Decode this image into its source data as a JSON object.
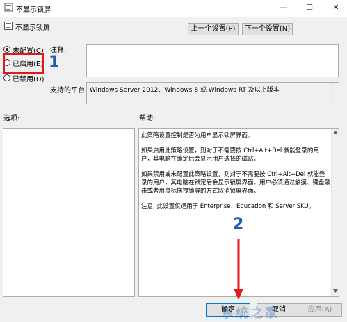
{
  "window": {
    "title": "不显示锁屏",
    "controls": {
      "minimize": "—",
      "maximize": "☐",
      "close": "✕"
    }
  },
  "header": {
    "title": "不显示锁屏"
  },
  "nav": {
    "prev_label": "上一个设置(P)",
    "next_label": "下一个设置(N)"
  },
  "radio": [
    {
      "label": "未配置(C)",
      "checked": true
    },
    {
      "label": "已启用(E)",
      "checked": false
    },
    {
      "label": "已禁用(D)",
      "checked": false
    }
  ],
  "comment": {
    "label": "注释:",
    "value": ""
  },
  "platform": {
    "label": "支持的平台:",
    "value": "Windows Server 2012、Windows 8 或 Windows RT 及以上版本"
  },
  "options": {
    "label": "选项:"
  },
  "help": {
    "label": "帮助:",
    "paragraphs": [
      "此策略设置控制是否为用户显示锁屏界面。",
      "如果启用此策略设置，则对于不需要按 Ctrl+Alt+Del 就能登录的用户，其电脑在锁定后会显示用户选择的磁贴。",
      "如果禁用或未配置此策略设置，则对于不需要按 Ctrl+Alt+Del 就能登录的用户，其电脑在锁定后会显示锁屏界面。用户必须通过触摸、键盘敲击或者用鼠标拖拽锁屏的方式取消锁屏界面。",
      "注意: 此设置仅适用于 Enterprise、Education 和 Server SKU。"
    ]
  },
  "buttons": {
    "ok": "确定",
    "cancel": "取消",
    "apply": "应用(A)"
  },
  "annotations": {
    "step1": "1",
    "step2": "2",
    "highlight_color": "#e01a1a",
    "number_color": "#1f5fad"
  },
  "watermark": "系统之家"
}
